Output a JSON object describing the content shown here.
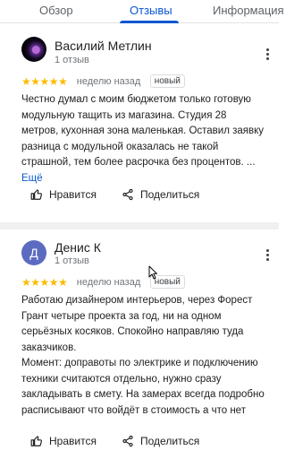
{
  "tabs": [
    {
      "label": "Обзор"
    },
    {
      "label": "Отзывы",
      "active": true
    },
    {
      "label": "Информация"
    }
  ],
  "colors": {
    "accent": "#0b57d0",
    "star": "#fbbc04"
  },
  "reviews": [
    {
      "author": "Василий Метлин",
      "count": "1 отзыв",
      "rating": 5,
      "stars": "★★★★★",
      "when": "неделю назад",
      "badge": "новый",
      "text": "Честно думал с моим бюджетом только готовую модульную тащить из магазина. Студия 28 метров, кухонная зона маленькая. Оставил заявку разница с модульной оказалась не такой страшной, тем более расрочка без процентов. ...",
      "more_link": "Ещё",
      "like_label": "Нравится",
      "share_label": "Поделиться"
    },
    {
      "author": "Денис К",
      "avatar_letter": "Д",
      "count": "1 отзыв",
      "rating": 5,
      "stars": "★★★★★",
      "when": "неделю назад",
      "badge": "новый",
      "text_p1": "Работаю дизайнером интерьеров, через Форест Грант четыре проекта за год, ни на одном серьёзных косяков. Спокойно направляю туда заказчиков.",
      "text_p2": "Момент: доправоты по электрике и подключению техники считаются отдельно, нужно сразу закладывать в смету. На замерах всегда подробно расписывают что войдёт в стоимость а что нет",
      "like_label": "Нравится",
      "share_label": "Поделиться"
    }
  ]
}
